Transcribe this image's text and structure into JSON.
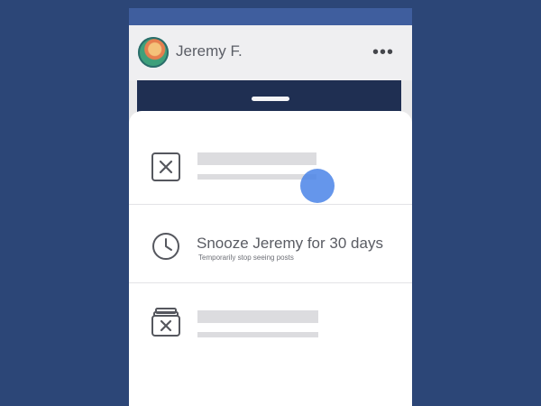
{
  "post": {
    "author": "Jeremy F."
  },
  "menu": {
    "snooze_title": "Snooze Jeremy for 30 days",
    "snooze_subtitle": "Temporarily stop seeing posts"
  },
  "icons": {
    "hide": "close-box-icon",
    "snooze": "clock-icon",
    "unfollow": "unfollow-icon"
  },
  "colors": {
    "background": "#2c4677",
    "brand_bar": "#3f5e9e",
    "touch_indicator": "#4a84e8"
  }
}
